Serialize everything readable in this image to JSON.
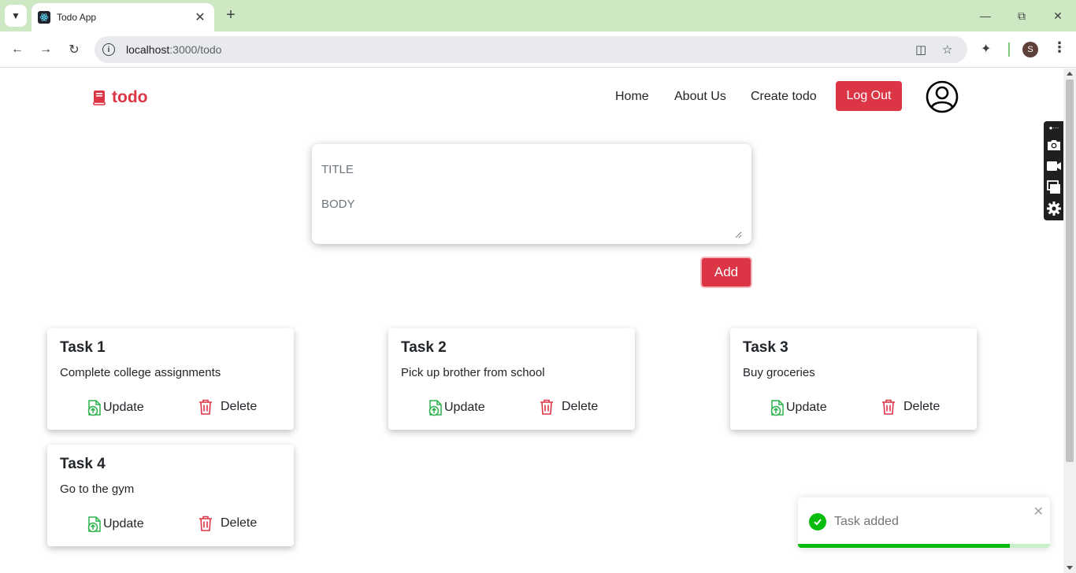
{
  "browser": {
    "tab_title": "Todo App",
    "url_host": "localhost",
    "url_path": ":3000/todo",
    "profile_initial": "S"
  },
  "navbar": {
    "brand": "todo",
    "links": [
      "Home",
      "About Us",
      "Create todo"
    ],
    "logout_label": "Log Out"
  },
  "form": {
    "title_placeholder": "TITLE",
    "body_placeholder": "BODY",
    "add_label": "Add"
  },
  "tasks": [
    {
      "title": "Task 1",
      "body": "Complete college assignments"
    },
    {
      "title": "Task 2",
      "body": "Pick up brother from school"
    },
    {
      "title": "Task 3",
      "body": "Buy groceries"
    },
    {
      "title": "Task 4",
      "body": "Go to the gym"
    }
  ],
  "card_actions": {
    "update_label": "Update",
    "delete_label": "Delete"
  },
  "toast": {
    "message": "Task added",
    "progress": 0.84,
    "status": "success"
  },
  "colors": {
    "accent": "#dc3545",
    "update_icon": "#2bb24c",
    "success": "#07bc0c",
    "tab_strip": "#cfe8c4"
  },
  "icons": {
    "brand": "book-icon",
    "update": "file-upload-icon",
    "delete": "trash-icon",
    "toast": "check-circle-icon",
    "avatar": "user-circle-icon"
  }
}
